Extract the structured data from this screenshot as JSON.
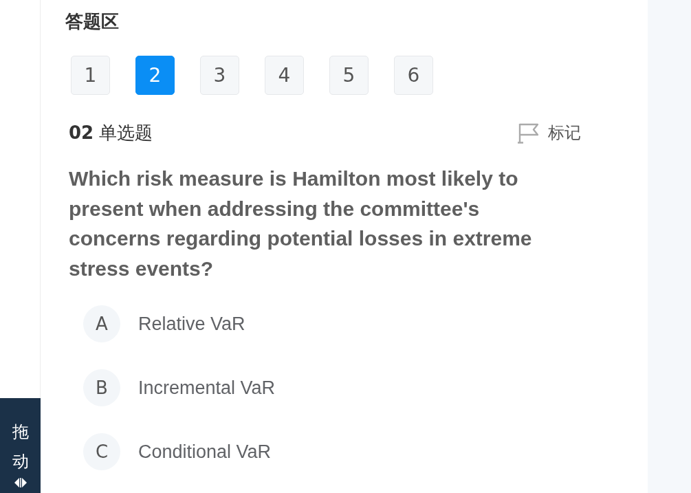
{
  "panel": {
    "title": "答题区"
  },
  "question_nav": [
    {
      "label": "1",
      "selected": false
    },
    {
      "label": "2",
      "selected": true
    },
    {
      "label": "3",
      "selected": false
    },
    {
      "label": "4",
      "selected": false
    },
    {
      "label": "5",
      "selected": false
    },
    {
      "label": "6",
      "selected": false
    }
  ],
  "question": {
    "heading": "**02** 单选题",
    "mark_label": "标记",
    "text": "Which risk measure is Hamilton most likely to present when addressing the committee's concerns regarding potential losses in extreme stress events?",
    "options": [
      {
        "letter": "A",
        "text": "Relative VaR",
        "selected": false
      },
      {
        "letter": "B",
        "text": "Incremental VaR",
        "selected": false
      },
      {
        "letter": "C",
        "text": "Conditional VaR",
        "selected": false
      }
    ]
  },
  "drag_handle": {
    "label": "拖动"
  }
}
